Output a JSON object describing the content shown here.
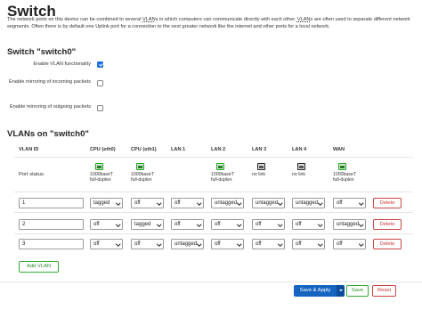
{
  "page": {
    "title": "Switch",
    "desc_parts": [
      "The network ports on this device can be combined to several ",
      "VLAN",
      "s in which computers can communicate directly with each other. ",
      "VLAN",
      "s are often used to separate different network segments. Often there is by default one Uplink port for a connection to the next greater network like the internet and other ports for a local network."
    ]
  },
  "switch": {
    "heading": "Switch \"switch0\"",
    "options": [
      {
        "label": "Enable VLAN functionality",
        "checked": true
      },
      {
        "label": "Enable mirroring of incoming packets",
        "checked": false
      },
      {
        "label": "Enable mirroring of outgoing packets",
        "checked": false
      }
    ]
  },
  "vlans": {
    "heading": "VLANs on \"switch0\"",
    "columns": [
      "VLAN ID",
      "CPU (eth0)",
      "CPU (eth1)",
      "LAN 1",
      "LAN 2",
      "LAN 3",
      "LAN 4",
      "WAN"
    ],
    "port_status_label": "Port status:",
    "port_status": [
      {
        "icon": "port-up-icon",
        "lines": [
          "1000baseT",
          "full-duplex"
        ]
      },
      {
        "icon": "port-up-icon",
        "lines": [
          "1000baseT",
          "full-duplex"
        ]
      },
      {
        "icon": "port-up-icon",
        "lines": [
          "1000baseT",
          "full-duplex"
        ]
      },
      {
        "icon": "port-down-icon",
        "lines": [
          "no link"
        ]
      },
      {
        "icon": "port-down-icon",
        "lines": [
          "no link"
        ]
      },
      {
        "icon": "port-up-icon",
        "lines": [
          "1000baseT",
          "full-duplex"
        ]
      }
    ],
    "rows": [
      {
        "id": "1",
        "ports": [
          "tagged",
          "off",
          "off",
          "untagged",
          "untagged",
          "untagged",
          "off"
        ],
        "delete_label": "Delete"
      },
      {
        "id": "2",
        "ports": [
          "off",
          "tagged",
          "off",
          "off",
          "off",
          "off",
          "untagged"
        ],
        "delete_label": "Delete"
      },
      {
        "id": "3",
        "ports": [
          "off",
          "off",
          "untagged",
          "off",
          "off",
          "off",
          "off"
        ],
        "delete_label": "Delete"
      }
    ],
    "add_label": "Add VLAN"
  },
  "footer": {
    "save_apply_label": "Save & Apply",
    "save_label": "Save",
    "reset_label": "Reset"
  },
  "colors": {
    "primary": "#1565c0",
    "positive": "#2a8a2a",
    "negative": "#cc3333",
    "checkbox": "#1a6fe0"
  }
}
